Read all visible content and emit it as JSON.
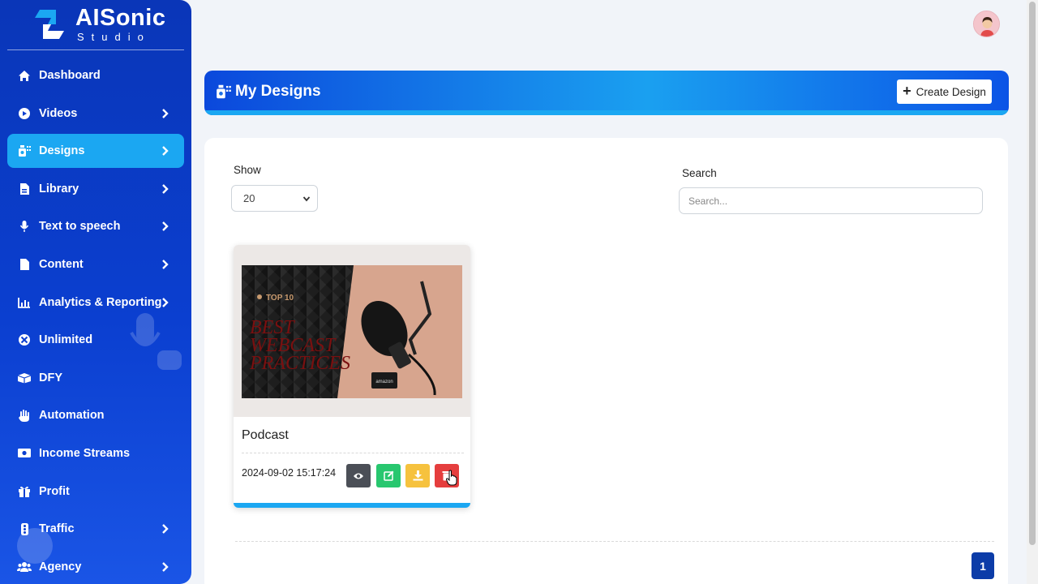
{
  "brand": {
    "name": "AISonic",
    "sub": "Studio"
  },
  "nav": [
    {
      "label": "Dashboard",
      "icon": "home-icon",
      "chevron": false
    },
    {
      "label": "Videos",
      "icon": "video-icon",
      "chevron": true
    },
    {
      "label": "Designs",
      "icon": "designs-icon",
      "chevron": true,
      "active": true
    },
    {
      "label": "Library",
      "icon": "file-icon",
      "chevron": true
    },
    {
      "label": "Text to speech",
      "icon": "microphone-icon",
      "chevron": true
    },
    {
      "label": "Content",
      "icon": "document-icon",
      "chevron": true
    },
    {
      "label": "Analytics & Reporting",
      "icon": "chart-icon",
      "chevron": true
    },
    {
      "label": "Unlimited",
      "icon": "infinity-circle-icon",
      "chevron": false
    },
    {
      "label": "DFY",
      "icon": "box-icon",
      "chevron": false
    },
    {
      "label": "Automation",
      "icon": "hand-icon",
      "chevron": false
    },
    {
      "label": "Income Streams",
      "icon": "money-icon",
      "chevron": false
    },
    {
      "label": "Profit",
      "icon": "gift-icon",
      "chevron": false
    },
    {
      "label": "Traffic",
      "icon": "traffic-light-icon",
      "chevron": true
    },
    {
      "label": "Agency",
      "icon": "users-icon",
      "chevron": true
    }
  ],
  "header": {
    "title": "My Designs",
    "create_label": "Create Design"
  },
  "controls": {
    "show_label": "Show",
    "show_value": "20",
    "search_label": "Search",
    "search_placeholder": "Search..."
  },
  "designs": [
    {
      "name": "Podcast",
      "date": "2024-09-02 15:17:24",
      "thumbnail": {
        "tag": "TOP 10",
        "lines": [
          "BEST",
          "WEBCAST",
          "PRACTICES"
        ],
        "badge": "amazon"
      }
    }
  ],
  "pagination": {
    "current": "1"
  },
  "colors": {
    "sidebar": "#0b3fd0",
    "accent": "#1ba7f2",
    "view": "#4b4f57",
    "edit": "#28c76f",
    "download": "#f6c23e",
    "delete": "#e53e3e"
  }
}
